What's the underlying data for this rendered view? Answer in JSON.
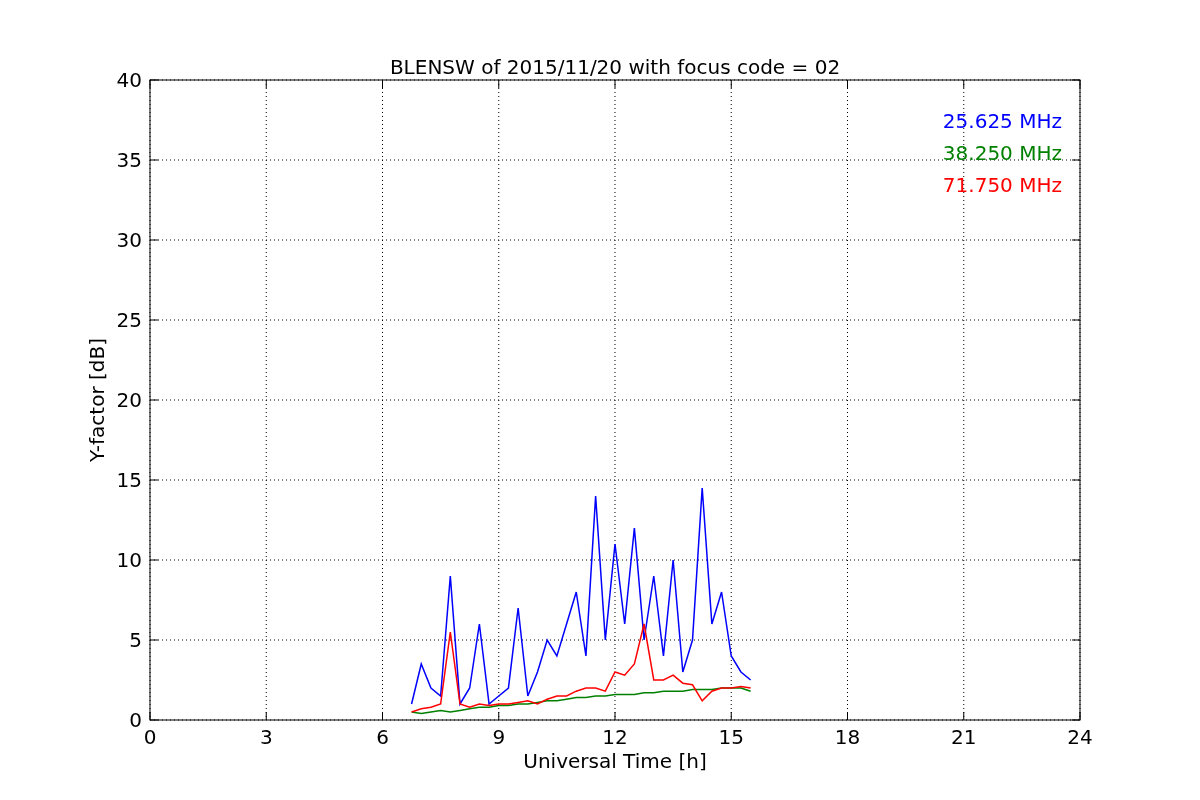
{
  "figure": {
    "chart_data": {
      "type": "line",
      "grid": true,
      "title": "BLENSW of 2015/11/20 with focus code = 02",
      "xlabel": "Universal Time [h]",
      "ylabel": "Y-factor [dB]",
      "xlim": [
        0,
        24
      ],
      "ylim": [
        0,
        40
      ],
      "xticks": [
        0,
        3,
        6,
        9,
        12,
        15,
        18,
        21,
        24
      ],
      "yticks": [
        0,
        5,
        10,
        15,
        20,
        25,
        30,
        35,
        40
      ],
      "x": [
        6.75,
        7,
        7.25,
        7.5,
        7.75,
        8,
        8.25,
        8.5,
        8.75,
        9,
        9.25,
        9.5,
        9.75,
        10,
        10.25,
        10.5,
        10.75,
        11,
        11.25,
        11.5,
        11.75,
        12,
        12.25,
        12.5,
        12.75,
        13,
        13.25,
        13.5,
        13.75,
        14,
        14.25,
        14.5,
        14.75,
        15,
        15.25,
        15.5
      ],
      "series": [
        {
          "name": "25.625 MHz",
          "color": "#0000ff",
          "values": [
            1,
            3.5,
            2,
            1.5,
            9,
            1,
            2,
            6,
            1,
            1.5,
            2,
            7,
            1.5,
            3,
            5,
            4,
            6,
            8,
            4,
            14,
            5,
            11,
            6,
            12,
            5,
            9,
            4,
            10,
            3,
            5,
            14.5,
            6,
            8,
            4,
            3,
            2.5
          ]
        },
        {
          "name": "38.250 MHz",
          "color": "#008000",
          "values": [
            0.5,
            0.4,
            0.5,
            0.6,
            0.5,
            0.6,
            0.7,
            0.8,
            0.8,
            0.9,
            0.9,
            1,
            1,
            1.1,
            1.2,
            1.2,
            1.3,
            1.4,
            1.4,
            1.5,
            1.5,
            1.6,
            1.6,
            1.6,
            1.7,
            1.7,
            1.8,
            1.8,
            1.8,
            1.9,
            1.9,
            1.9,
            2,
            2,
            2,
            1.8
          ]
        },
        {
          "name": "71.750 MHz",
          "color": "#ff0000",
          "values": [
            0.5,
            0.7,
            0.8,
            1,
            5.5,
            1,
            0.8,
            1,
            0.9,
            1,
            1,
            1.1,
            1.2,
            1,
            1.3,
            1.5,
            1.5,
            1.8,
            2,
            2,
            1.8,
            3,
            2.8,
            3.5,
            6,
            2.5,
            2.5,
            2.8,
            2.3,
            2.2,
            1.2,
            1.8,
            2,
            2,
            2.1,
            2
          ]
        }
      ]
    }
  }
}
